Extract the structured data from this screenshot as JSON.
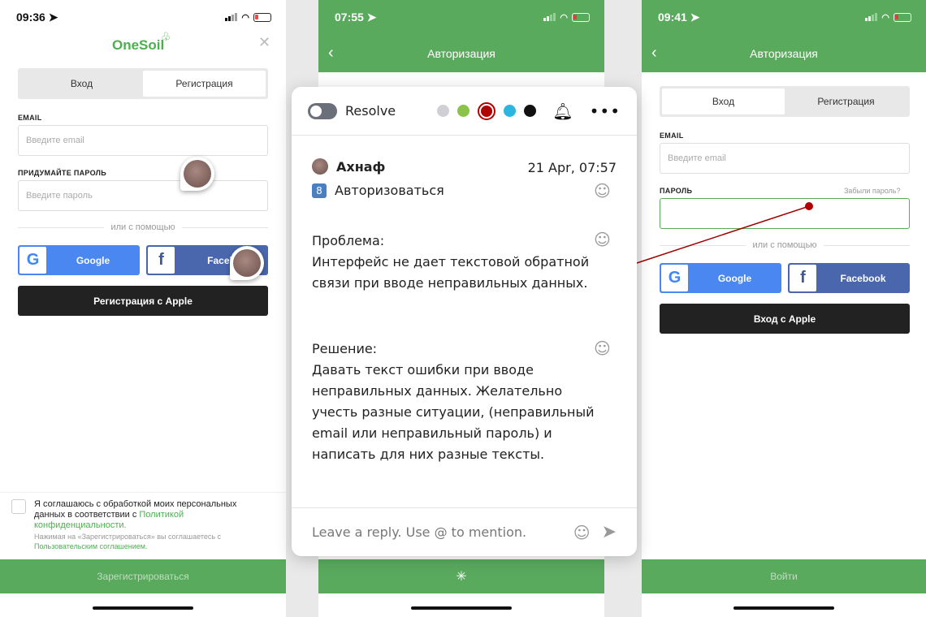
{
  "phone1": {
    "status": {
      "time": "09:36 ➤"
    },
    "logo": "OneSoil",
    "tabs": [
      "Вход",
      "Регистрация"
    ],
    "email_label": "EMAIL",
    "email_placeholder": "Введите email",
    "password_label": "ПРИДУМАЙТЕ ПАРОЛЬ",
    "password_placeholder": "Введите пароль",
    "or_label": "или с помощью",
    "google_label": "Google",
    "facebook_label": "Faceb",
    "apple_label": " Регистрация с Apple",
    "consent_text": "Я соглашаюсь с обработкой моих персональных данных в соответствии с ",
    "consent_link": "Политикой конфиденциальности.",
    "consent_small": "Нажимая на «Зарегистрироваться» вы соглашаетесь с ",
    "consent_small_link": "Пользовательским соглашением.",
    "cta_label": "Зарегистрироваться"
  },
  "phone2": {
    "status": {
      "time": "07:55 ➤"
    },
    "nav_title": "Авторизация"
  },
  "phone3": {
    "status": {
      "time": "09:41 ➤"
    },
    "nav_title": "Авторизация",
    "tabs": [
      "Вход",
      "Регистрация"
    ],
    "email_label": "EMAIL",
    "email_placeholder": "Введите email",
    "password_label": "ПАРОЛЬ",
    "forgot_label": "Забыли пароль?",
    "or_label": "или с помощью",
    "google_label": "Google",
    "facebook_label": "Facebook",
    "apple_label": " Вход с Apple",
    "cta_label": "Войти"
  },
  "comment": {
    "resolve_label": "Resolve",
    "colors": [
      "#cfcfd6",
      "#8bc34a",
      "#b00000",
      "#2bb5e0",
      "#111111"
    ],
    "selected_color": "#b00000",
    "author": "Ахнаф",
    "date": "21 Apr, 07:57",
    "tag_number": "8",
    "tag_text": "Авторизоваться",
    "problem": "Проблема:\nИнтерфейс не дает текстовой обратной связи при вводе неправильных данных.",
    "solution": "Решение:\nДавать текст ошибки при вводе неправильных данных. Желательно учесть разные ситуации, (неправильный email или неправильный пароль) и написать для них разные тексты.",
    "reply_placeholder": "Leave a reply. Use @ to mention."
  }
}
